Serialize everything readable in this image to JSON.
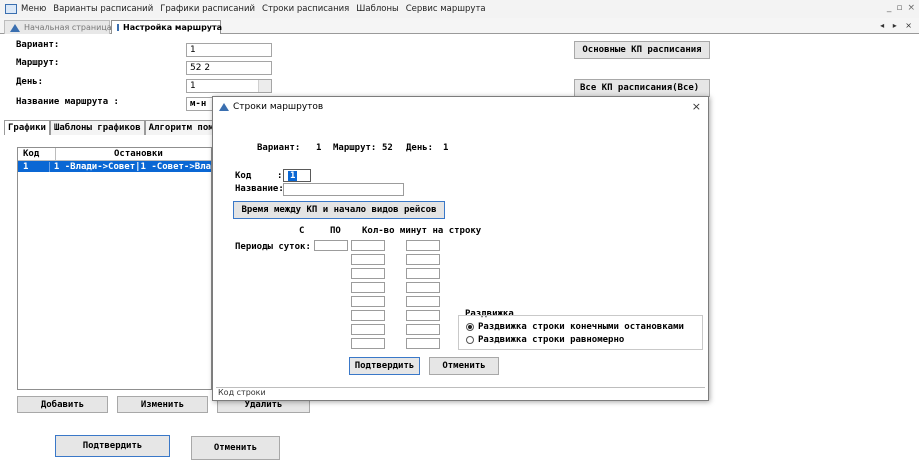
{
  "menu": {
    "items": [
      "Меню",
      "Варианты расписаний",
      "Графики расписаний",
      "Строки расписания",
      "Шаблоны",
      "Сервис маршрута"
    ],
    "window_controls": [
      "_",
      "▫",
      "×"
    ]
  },
  "doctabs": {
    "home": "Начальная страница",
    "route": "Настройка маршрута",
    "nav": "◂ ▸ ×"
  },
  "form": {
    "variant_label": "Вариант:",
    "variant_value": "1",
    "route_label": "Маршрут:",
    "route_value": "52  2",
    "day_label": "День:",
    "day_value": "1",
    "route_name_label": "Название маршрута :",
    "route_name_value": "м-н",
    "main_kp_button": "Основные КП расписания",
    "all_kp_button": "Все КП расписания(Все)"
  },
  "inner_tabs": [
    "Графики",
    "Шаблоны графиков",
    "Алгоритм пом"
  ],
  "list": {
    "headers": [
      "Код",
      "Остановки"
    ],
    "rows": [
      {
        "code": "1",
        "stops": "1 -Влади->Совет|1 -Совет->Вла"
      }
    ]
  },
  "bottom_buttons": {
    "add": "Добавить",
    "edit": "Изменить",
    "delete": "Удалить",
    "confirm": "Подтвердить",
    "cancel": "Отменить"
  },
  "dialog": {
    "title": "Строки маршрутов",
    "close": "×",
    "info_variant_label": "Вариант:",
    "info_variant_value": "1",
    "info_route_label": "Маршрут:",
    "info_route_value": "52",
    "info_day_label": "День:",
    "info_day_value": "1",
    "code_label": "Код",
    "code_colon": ":",
    "code_value": "1",
    "name_label": "Название:",
    "time_button": "Время между КП и начало видов рейсов",
    "col_from": "С",
    "col_to": "ПО",
    "col_minutes": "Кол-во минут на строку",
    "periods_label": "Периоды суток:",
    "spread_title": "Раздвижка",
    "radio_terminal": "Раздвижка строки конечными остановками",
    "radio_uniform": "Раздвижка строки равномерно",
    "confirm": "Подтвердить",
    "cancel": "Отменить",
    "status": "Код строки"
  },
  "colors": {
    "selection": "#0a67d4",
    "focus_border": "#3a78c8"
  }
}
